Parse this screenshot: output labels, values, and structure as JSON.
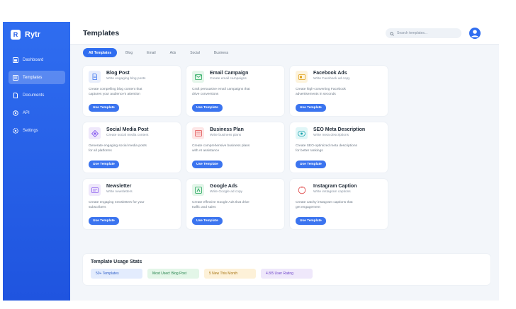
{
  "brand": {
    "logo_letter": "R",
    "name": "Rytr"
  },
  "sidebar": {
    "items": [
      {
        "label": "Dashboard",
        "icon": "dashboard-icon",
        "active": false
      },
      {
        "label": "Templates",
        "icon": "templates-icon",
        "active": true
      },
      {
        "label": "Documents",
        "icon": "documents-icon",
        "active": false
      },
      {
        "label": "API",
        "icon": "api-icon",
        "active": false
      },
      {
        "label": "Settings",
        "icon": "settings-icon",
        "active": false
      }
    ]
  },
  "header": {
    "title": "Templates",
    "search_placeholder": "Search templates...",
    "search_value": ""
  },
  "tabs": [
    {
      "label": "All Templates",
      "active": true
    },
    {
      "label": "Blog",
      "active": false
    },
    {
      "label": "Email",
      "active": false
    },
    {
      "label": "Ads",
      "active": false
    },
    {
      "label": "Social",
      "active": false
    },
    {
      "label": "Business",
      "active": false
    }
  ],
  "cards": [
    {
      "title": "Blog Post",
      "subtitle": "Write engaging blog posts",
      "desc": "Create compelling blog content that captures your audience's attention",
      "button": "Use Template",
      "icon": "document-icon",
      "icon_bg": "#e8eefc",
      "icon_color": "#3b74ef"
    },
    {
      "title": "Email Campaign",
      "subtitle": "Create email campaigns",
      "desc": "Craft persuasive email campaigns that drive conversions",
      "button": "Use Template",
      "icon": "envelope-icon",
      "icon_bg": "#e4f6ea",
      "icon_color": "#22a65a"
    },
    {
      "title": "Facebook Ads",
      "subtitle": "Write Facebook ad copy",
      "desc": "Create high-converting Facebook advertisements in seconds",
      "button": "Use Template",
      "icon": "ad-icon",
      "icon_bg": "#fdf3dc",
      "icon_color": "#e0a21a"
    },
    {
      "title": "Social Media Post",
      "subtitle": "Create social media content",
      "desc": "Generate engaging social media posts for all platforms",
      "button": "Use Template",
      "icon": "diamond-icon",
      "icon_bg": "#efe8fb",
      "icon_color": "#8a5cf0"
    },
    {
      "title": "Business Plan",
      "subtitle": "Write business plans",
      "desc": "Create comprehensive business plans with AI assistance",
      "button": "Use Template",
      "icon": "plan-icon",
      "icon_bg": "#fde6e6",
      "icon_color": "#e04b4b"
    },
    {
      "title": "SEO Meta Description",
      "subtitle": "Write meta descriptions",
      "desc": "Create SEO-optimized meta descriptions for better rankings",
      "button": "Use Template",
      "icon": "seo-icon",
      "icon_bg": "#e0f6f7",
      "icon_color": "#18a3ad"
    },
    {
      "title": "Newsletter",
      "subtitle": "Write newsletters",
      "desc": "Create engaging newsletters for your subscribers",
      "button": "Use Template",
      "icon": "newsletter-icon",
      "icon_bg": "#efe8fb",
      "icon_color": "#8a5cf0"
    },
    {
      "title": "Google Ads",
      "subtitle": "Write Google ad copy",
      "desc": "Create effective Google Ads that drive traffic and sales",
      "button": "Use Template",
      "icon": "google-ads-icon",
      "icon_bg": "#e4f6ea",
      "icon_color": "#22a65a"
    },
    {
      "title": "Instagram Caption",
      "subtitle": "Write instagram captions",
      "desc": "Create catchy instagram captions that get engagement",
      "button": "Use Template",
      "icon": "instagram-icon",
      "icon_bg": "#fde6e6",
      "icon_color": "#e04b4b"
    }
  ],
  "stats": {
    "title": "Template Usage Stats",
    "chips": [
      {
        "label": "50+ Templates",
        "bg": "#e3ecfd",
        "color": "#2f5fc7"
      },
      {
        "label": "Most Used: Blog Post",
        "bg": "#e3f6e8",
        "color": "#22804a"
      },
      {
        "label": "5 New This Month",
        "bg": "#fdf1d8",
        "color": "#a77412"
      },
      {
        "label": "4.8/5 User Rating",
        "bg": "#efe8fb",
        "color": "#6e44c9"
      }
    ]
  },
  "colors": {
    "accent": "#2f6df0",
    "sidebar_dark": "#1f54df",
    "background": "#f3f6fa"
  }
}
